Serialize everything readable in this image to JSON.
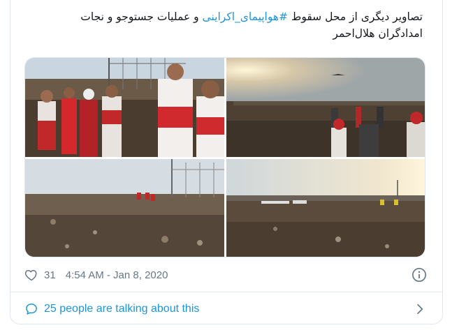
{
  "tweet": {
    "text_before": "تصاویر دیگری از محل سقوط",
    "hashtag": "#هواپیمای_اکراینی",
    "text_after": "و عملیات جستوجو و نجات امدادگران هلال‌احمر"
  },
  "media": {
    "photos": [
      {
        "icon": "photo-rescue-workers"
      },
      {
        "icon": "photo-crash-field-sunrise"
      },
      {
        "icon": "photo-debris-field"
      },
      {
        "icon": "photo-wide-crash-site"
      }
    ]
  },
  "meta": {
    "like_icon": "heart-icon",
    "like_count": "31",
    "timestamp": "4:54 AM - Jan 8, 2020",
    "info_icon": "info-icon"
  },
  "conversation": {
    "icon": "speech-bubble-icon",
    "label": "25 people are talking about this",
    "chevron": "chevron-right-icon"
  },
  "colors": {
    "link": "#1b95e0",
    "muted": "#657786",
    "border": "#e1e8ed"
  }
}
